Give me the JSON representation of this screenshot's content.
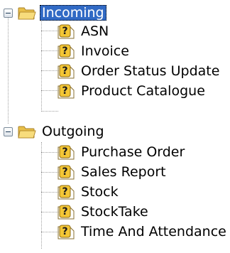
{
  "tree": {
    "groups": [
      {
        "label": "Incoming",
        "expanded": true,
        "selected": true,
        "icon": "folder-open-icon",
        "children": [
          {
            "label": "ASN",
            "icon": "unknown-document-icon"
          },
          {
            "label": "Invoice",
            "icon": "unknown-document-icon"
          },
          {
            "label": "Order Status Update",
            "icon": "unknown-document-icon"
          },
          {
            "label": "Product Catalogue",
            "icon": "unknown-document-icon"
          }
        ]
      },
      {
        "label": "Outgoing",
        "expanded": true,
        "selected": false,
        "icon": "folder-open-icon",
        "children": [
          {
            "label": "Purchase Order",
            "icon": "unknown-document-icon"
          },
          {
            "label": "Sales Report",
            "icon": "unknown-document-icon"
          },
          {
            "label": "Stock",
            "icon": "unknown-document-icon"
          },
          {
            "label": "StockTake",
            "icon": "unknown-document-icon"
          },
          {
            "label": "Time And Attendance",
            "icon": "unknown-document-icon"
          }
        ]
      }
    ]
  },
  "colors": {
    "selection": "#316ac5",
    "folder": "#f5d36a",
    "document_badge": "#e8b828"
  }
}
